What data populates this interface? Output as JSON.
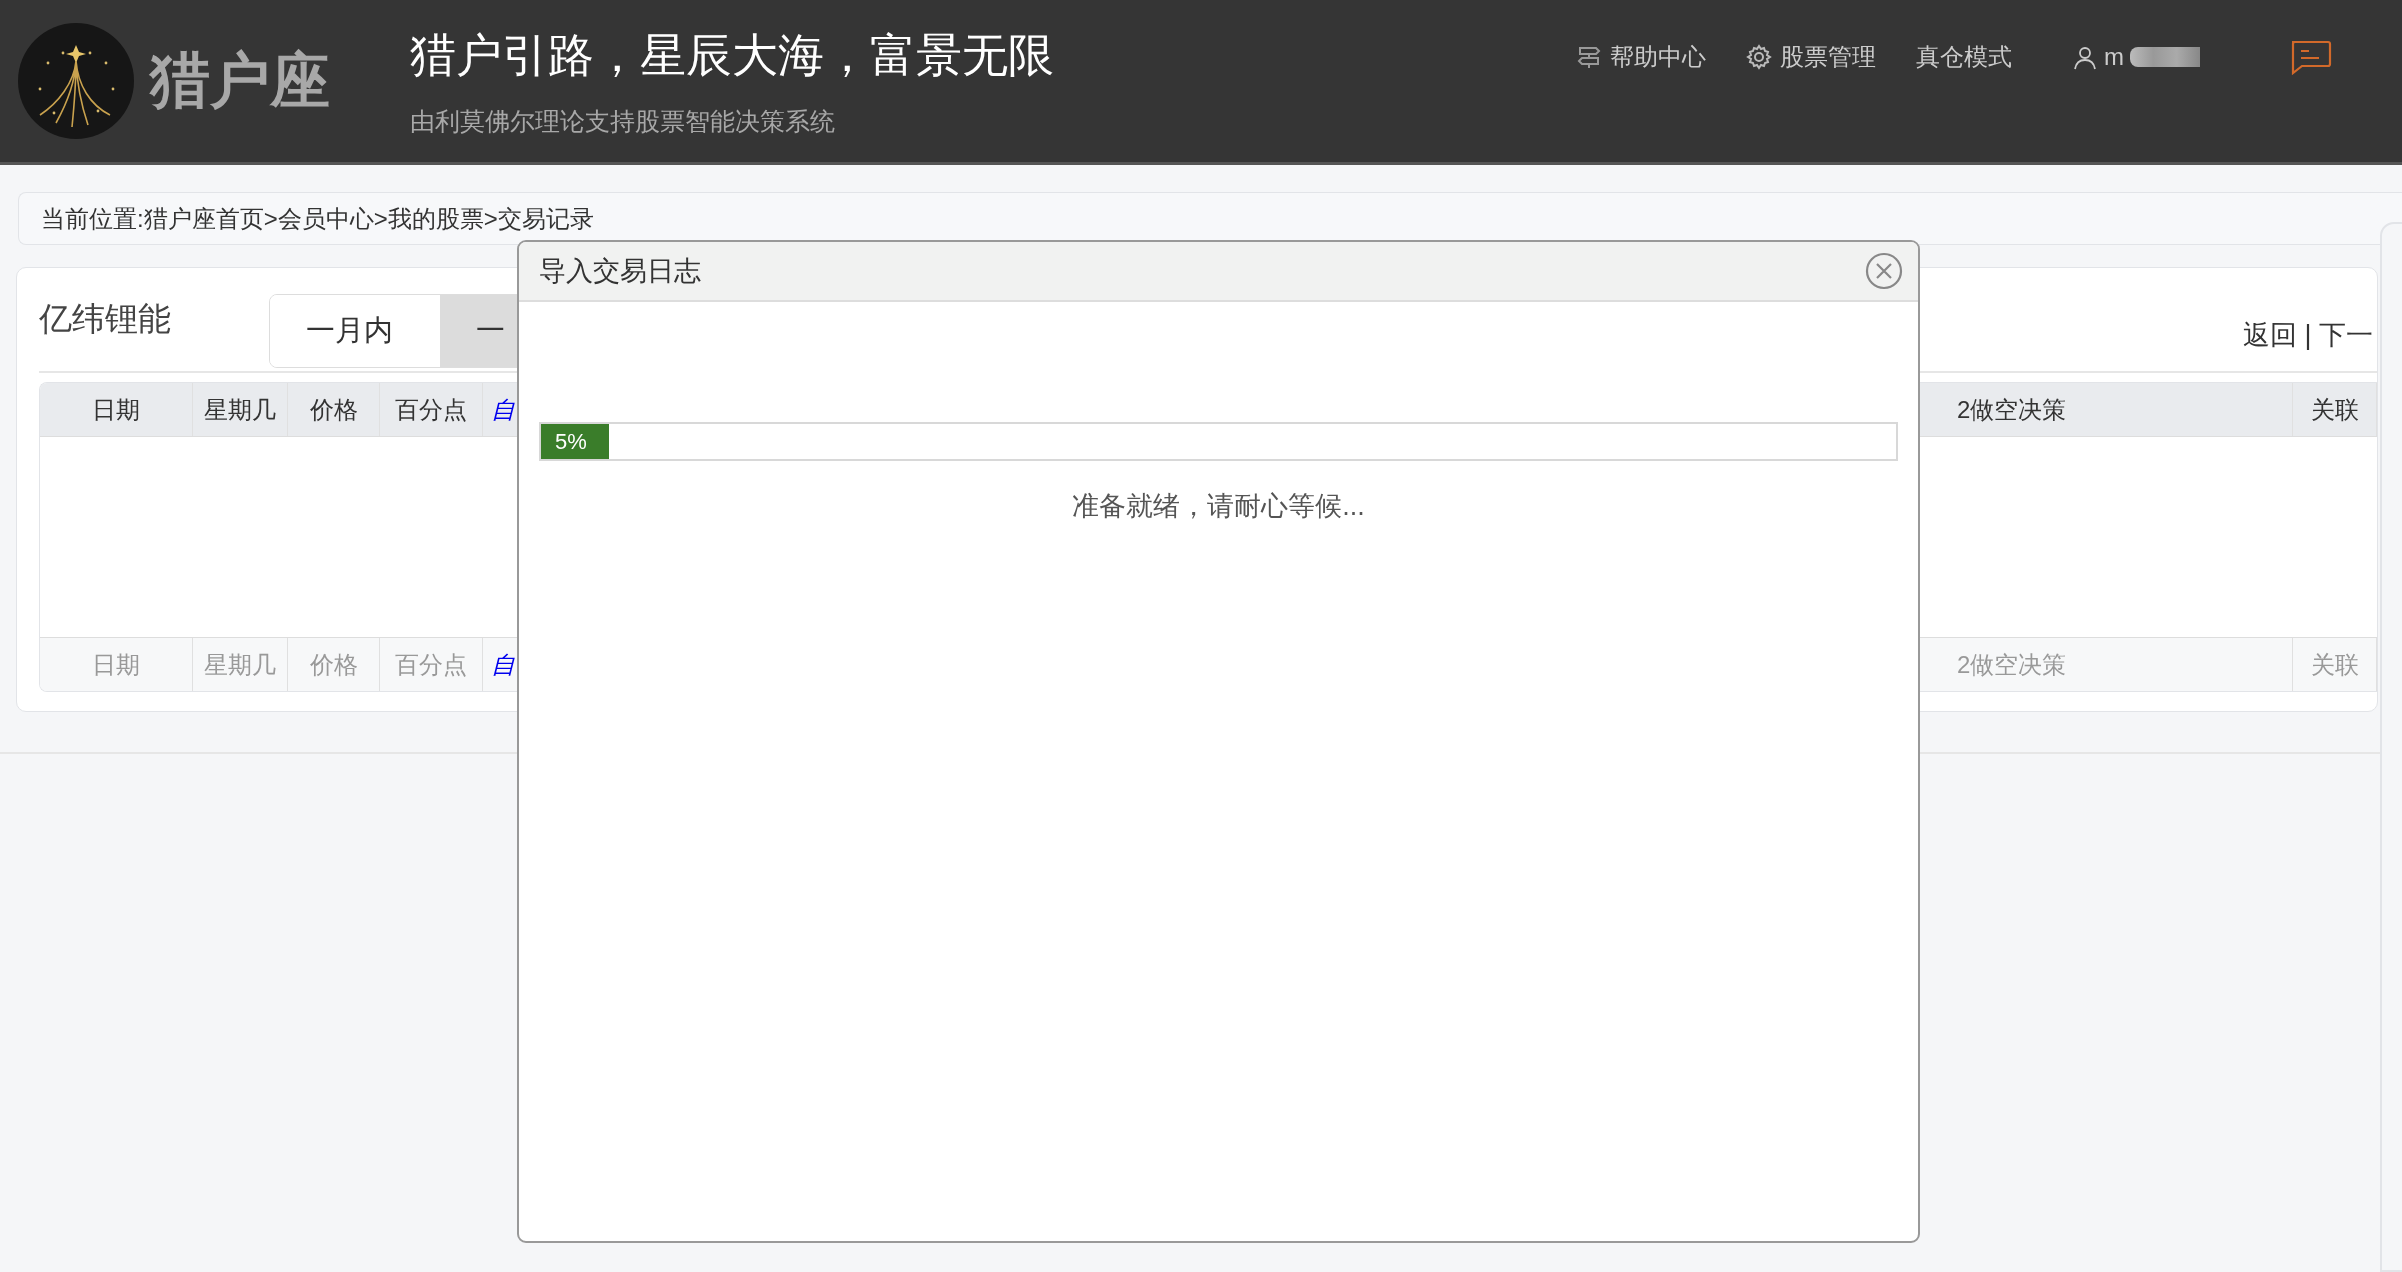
{
  "header": {
    "brand": "猎户座",
    "slogan": "猎户引路，星辰大海，富景无限",
    "subtitle": "由利莫佛尔理论支持股票智能决策系统",
    "nav": [
      {
        "kind": "help",
        "label": "帮助中心"
      },
      {
        "kind": "settings",
        "label": "股票管理"
      },
      {
        "kind": "plain",
        "label": "真仓模式"
      }
    ],
    "user": "m"
  },
  "breadcrumb": "当前位置:猎户座首页>会员中心>我的股票>交易记录",
  "stock": {
    "name": "亿纬锂能",
    "periods": [
      {
        "label": "一月内",
        "selected": true
      },
      {
        "label": "一",
        "selected": false
      }
    ],
    "links": "返回 | 下一"
  },
  "table": {
    "columns_left": [
      {
        "label": "日期",
        "kind": "text"
      },
      {
        "label": "星期几",
        "kind": "text"
      },
      {
        "label": "价格",
        "kind": "text"
      },
      {
        "label": "百分点",
        "kind": "text"
      },
      {
        "label": "自",
        "kind": "link"
      }
    ],
    "columns_right": [
      {
        "label": "2做空决策"
      },
      {
        "label": "关联"
      }
    ],
    "footer_left": [
      {
        "label": "日期",
        "kind": "text"
      },
      {
        "label": "星期几",
        "kind": "text"
      },
      {
        "label": "价格",
        "kind": "text"
      },
      {
        "label": "百分点",
        "kind": "text"
      },
      {
        "label": "自",
        "kind": "link"
      }
    ],
    "footer_right": [
      {
        "label": "2做空决策"
      },
      {
        "label": "关联"
      }
    ]
  },
  "dialog": {
    "title": "导入交易日志",
    "progress": {
      "level": 0.05,
      "reading": "5%"
    },
    "status": "准备就绪，请耐心等候..."
  }
}
